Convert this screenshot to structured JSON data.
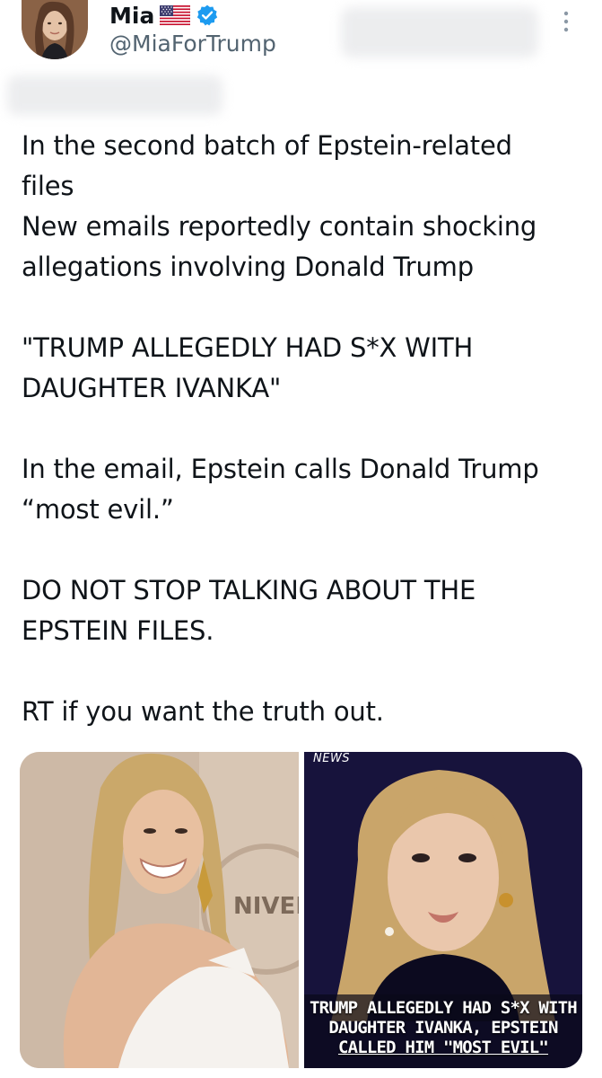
{
  "author": {
    "display_name": "Mia",
    "handle": "@MiaForTrump",
    "flag_icon": "us-flag-icon",
    "verified_icon": "verified-badge-icon",
    "verified_color": "#1d9bf0"
  },
  "tweet": {
    "paragraphs": [
      "In the second batch of Epstein-related\nfiles\nNew emails reportedly contain shocking\nallegations involving Donald Trump",
      "\"TRUMP ALLEGEDLY HAD S*X WITH\nDAUGHTER IVANKA\"",
      "In the email, Epstein calls Donald Trump\n“most evil.”",
      "DO NOT STOP TALKING ABOUT THE\nEPSTEIN FILES.",
      "RT if you want the truth out."
    ]
  },
  "media": {
    "left_image": {
      "description_icon": "photo-icon",
      "backdrop_text": "NIVEI"
    },
    "right_image": {
      "tag": "NEWS",
      "caption_lines": [
        "TRUMP ALLEGEDLY HAD S*X WITH",
        "DAUGHTER IVANKA, EPSTEIN",
        "CALLED HIM \"MOST EVIL\""
      ]
    }
  },
  "colors": {
    "text": "#0f1419",
    "secondary": "#536471",
    "accent": "#1d9bf0"
  }
}
